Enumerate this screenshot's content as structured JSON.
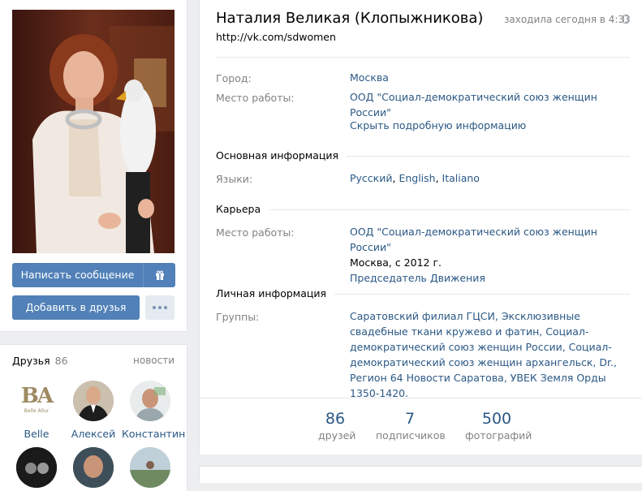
{
  "profile": {
    "name": "Наталия Великая (Клопыжникова)",
    "online": "заходила сегодня в 4:33",
    "status": "http://vk.com/sdwomen"
  },
  "actions": {
    "message": "Написать сообщение",
    "add_friend": "Добавить в друзья"
  },
  "short_info": [
    {
      "label": "Город:",
      "value": "Москва"
    },
    {
      "label": "Место работы:",
      "value": "ООД \"Социал-демократический союз женщин России\""
    }
  ],
  "toggle_details": "Скрыть подробную информацию",
  "sections": {
    "main": {
      "title": "Основная информация",
      "languages_label": "Языки:",
      "languages": [
        "Русский",
        "English",
        "Italiano"
      ]
    },
    "career": {
      "title": "Карьера",
      "label": "Место работы:",
      "org": "ООД \"Социал-демократический союз женщин России\"",
      "period": "Москва, с 2012 г.",
      "position": "Председатель Движения"
    },
    "personal": {
      "title": "Личная информация",
      "groups_label": "Группы:",
      "groups": "Саратовский филиал ГЦСИ, Эксклюзивные свадебные ткани кружево и фатин, Социал-демократический союз женщин России, Социал-демократический союз женщин архангельск, Dr., Регион 64 Новости Саратова, УВЕК Земля Орды 1350-1420."
    }
  },
  "counters": [
    {
      "num": "86",
      "label": "друзей"
    },
    {
      "num": "7",
      "label": "подписчиков"
    },
    {
      "num": "500",
      "label": "фотографий"
    }
  ],
  "friends": {
    "title": "Друзья",
    "count": "86",
    "news": "новости",
    "items": [
      {
        "name": "Belle",
        "logo_text": "BA",
        "logo_sub": "Belle Allur"
      },
      {
        "name": "Алексей"
      },
      {
        "name": "Константин"
      }
    ]
  },
  "colors": {
    "accent": "#5181b8",
    "link": "#2a5885",
    "muted": "#828282",
    "background": "#edeef0"
  }
}
